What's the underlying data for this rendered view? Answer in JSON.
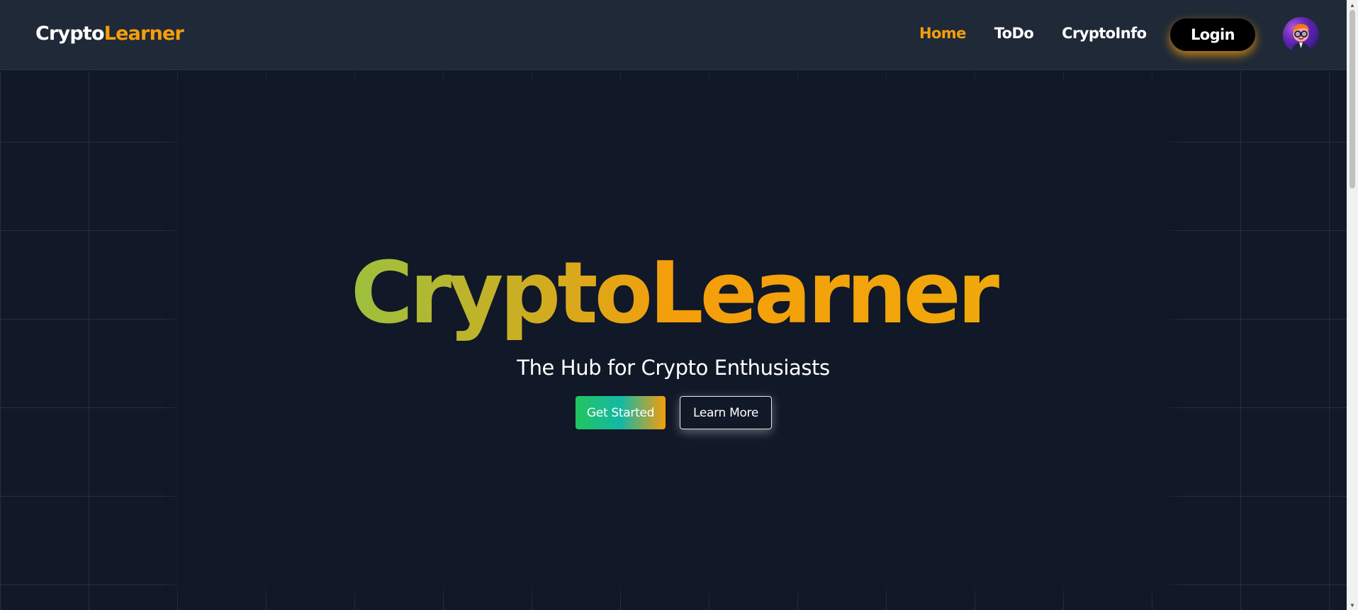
{
  "navbar": {
    "logo_primary": "Crypto",
    "logo_accent": "Learner",
    "links": [
      {
        "label": "Home",
        "active": true
      },
      {
        "label": "ToDo",
        "active": false
      },
      {
        "label": "CryptoInfo",
        "active": false
      }
    ],
    "login_label": "Login",
    "avatar_icon": "user-avatar-icon"
  },
  "hero": {
    "title": "CryptoLearner",
    "subtitle": "The Hub for Crypto Enthusiasts",
    "primary_button": "Get Started",
    "secondary_button": "Learn More"
  },
  "scrollbar": {
    "up_arrow": "▲",
    "down_arrow": "▼"
  },
  "colors": {
    "background": "#111827",
    "navbar": "#1f2937",
    "accent_orange": "#f59e0b",
    "gradient_green": "#4ade80",
    "gradient_yellow": "#eab308",
    "login_button": "#000000"
  }
}
